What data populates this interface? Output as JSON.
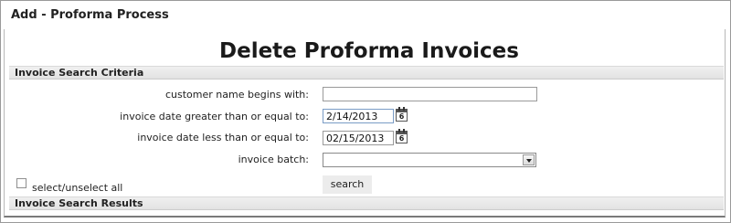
{
  "window": {
    "title": "Add - Proforma Process"
  },
  "page": {
    "heading": "Delete Proforma Invoices"
  },
  "criteria_section": {
    "title": "Invoice Search Criteria",
    "customer_name_label": "customer name begins with:",
    "customer_name_value": "",
    "date_from_label": "invoice date greater than or equal to:",
    "date_from_value": "2/14/2013",
    "date_to_label": "invoice date less than or equal to:",
    "date_to_value": "02/15/2013",
    "batch_label": "invoice batch:",
    "batch_value": "",
    "calendar_day": "6",
    "select_all_label": "select/unselect all",
    "search_button_label": "search"
  },
  "results_section": {
    "title": "Invoice Search Results"
  },
  "icons": {
    "calendar": "calendar-icon",
    "dropdown": "chevron-down-icon"
  },
  "colors": {
    "section_bar": "#e8e8e8",
    "frame_border": "#9a9a9a",
    "focused_input_border": "#7a9cc6"
  }
}
